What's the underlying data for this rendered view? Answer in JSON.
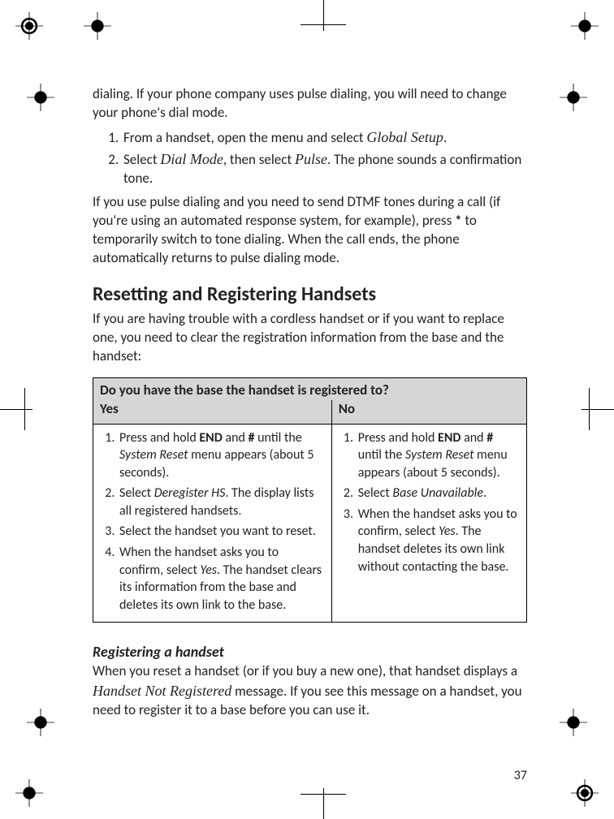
{
  "intro_para": "dialing. If your phone company uses pulse dialing, you will need to change your phone's dial mode.",
  "steps_intro": [
    {
      "pre": "From a handset, open the menu and select ",
      "serif": "Global Setup",
      "post": "."
    },
    {
      "pre": "Select ",
      "serif": "Dial Mode",
      "mid": ", then select ",
      "serif2": "Pulse",
      "post": ". The phone sounds a confirmation tone."
    }
  ],
  "pulse_para_a": "If you use pulse dialing and you need to send DTMF tones during a call (if you're using an automated response system, for example), press ",
  "pulse_star": "*",
  "pulse_para_b": " to temporarily switch to tone dialing. When the call ends, the phone automatically returns to pulse dialing mode.",
  "h2": "Resetting and Registering Handsets",
  "reset_intro": "If you are having trouble with a cordless handset or if you want to replace one, you need to clear the registration information from the base and the handset:",
  "table": {
    "question": "Do you have the base the handset is registered to?",
    "yes": "Yes",
    "no": "No",
    "yes_steps": {
      "s1a": "Press and hold ",
      "s1b": "END",
      "s1c": " and ",
      "s1d": "#",
      "s1e": " until the ",
      "s1f": "System Reset",
      "s1g": " menu appears (about 5 seconds).",
      "s2a": "Select ",
      "s2b": "Deregister HS",
      "s2c": ". The display lists all registered handsets.",
      "s3": "Select the handset you want to reset.",
      "s4a": "When the handset asks you to confirm, select ",
      "s4b": "Yes",
      "s4c": ". The handset clears its information from the base and deletes its own link to the base."
    },
    "no_steps": {
      "s1a": "Press and hold ",
      "s1b": "END",
      "s1c": " and ",
      "s1d": "#",
      "s1e": " until the ",
      "s1f": "System Reset",
      "s1g": " menu appears (about 5 seconds).",
      "s2a": "Select ",
      "s2b": "Base Unavailable",
      "s2c": ".",
      "s3a": "When the handset asks you to confirm, select ",
      "s3b": "Yes",
      "s3c": ". The handset deletes its own link without contacting the base."
    }
  },
  "h3": "Registering a handset",
  "reg_a": "When you reset a handset (or if you buy a new one), that handset displays a ",
  "reg_serif": "Handset Not Registered",
  "reg_b": " message. If you see this message on a handset, you need to register it to a base before you can use it.",
  "page_number": "37"
}
